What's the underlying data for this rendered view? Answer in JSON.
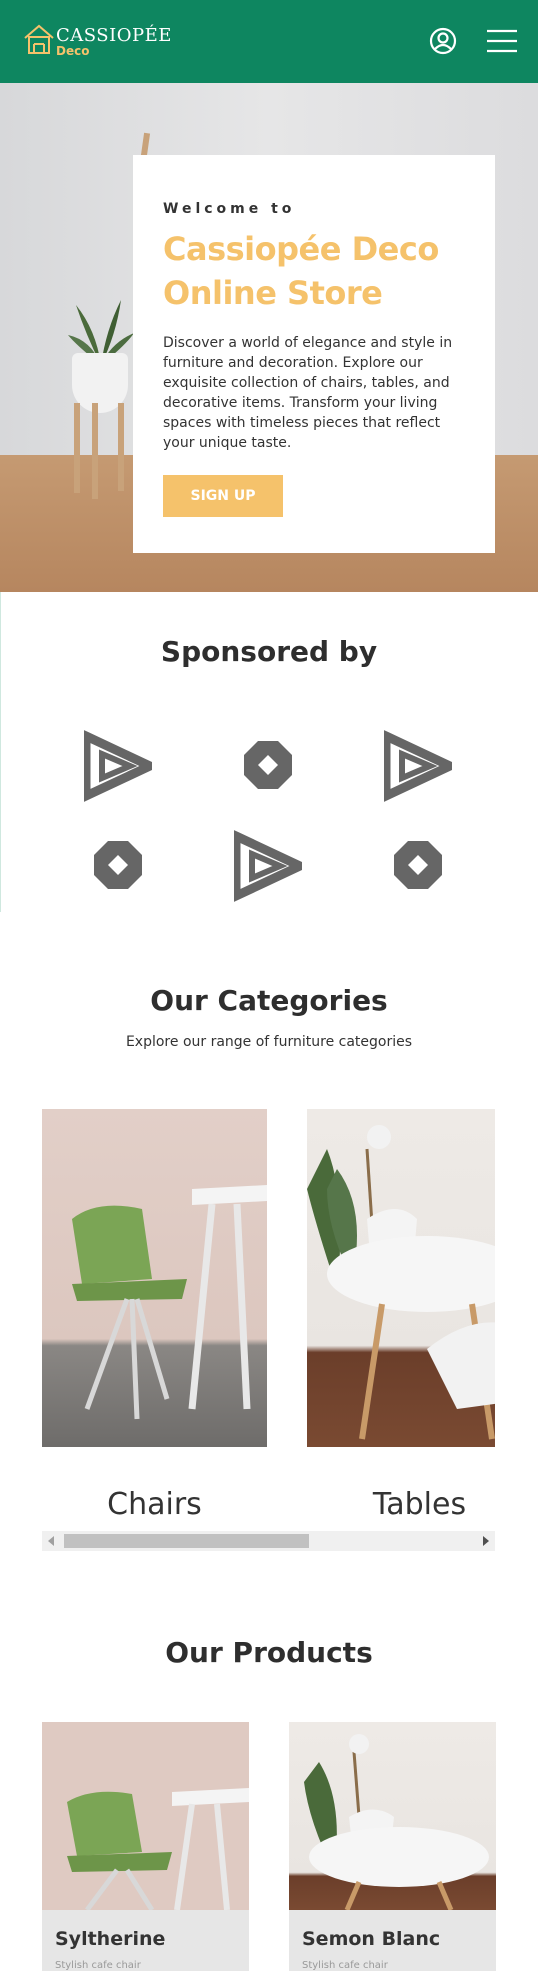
{
  "header": {
    "logo_name": "CASSIOPÉE",
    "logo_sub": "Deco",
    "icons": {
      "user": "user-circle-icon",
      "menu": "hamburger-menu-icon"
    },
    "colors": {
      "brand_green": "#0e8660",
      "accent_gold": "#f5c26b"
    }
  },
  "hero": {
    "welcome": "Welcome to",
    "title": "Cassiopée Deco Online Store",
    "description": "Discover a world of elegance and style in furniture and decoration. Explore our exquisite collection of chairs, tables, and decorative items. Transform your living spaces with timeless pieces that reflect your unique taste.",
    "cta_label": "SIGN UP"
  },
  "sponsors": {
    "title": "Sponsored by",
    "logos": [
      "triangle-logo-icon",
      "diamond-logo-icon",
      "triangle-logo-icon",
      "diamond-logo-icon",
      "triangle-logo-icon",
      "diamond-logo-icon"
    ]
  },
  "categories": {
    "title": "Our Categories",
    "subtitle": "Explore our range of furniture categories",
    "items": [
      {
        "label": "Chairs"
      },
      {
        "label": "Tables"
      }
    ]
  },
  "products": {
    "title": "Our Products",
    "items": [
      {
        "name": "Syltherine",
        "description": "Stylish cafe chair"
      },
      {
        "name": "Semon Blanc",
        "description": "Stylish cafe chair"
      }
    ]
  }
}
